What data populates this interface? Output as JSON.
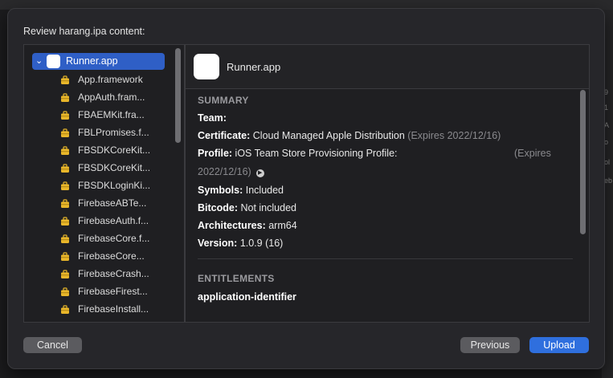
{
  "backdrop": {
    "glyphs": [
      "9",
      "1",
      "A",
      "o",
      "ol",
      "eb"
    ]
  },
  "sheet": {
    "title": "Review harang.ipa content:"
  },
  "tree": {
    "root": {
      "label": "Runner.app"
    },
    "items": [
      {
        "label": "App.framework"
      },
      {
        "label": "AppAuth.fram..."
      },
      {
        "label": "FBAEMKit.fra..."
      },
      {
        "label": "FBLPromises.f..."
      },
      {
        "label": "FBSDKCoreKit..."
      },
      {
        "label": "FBSDKCoreKit..."
      },
      {
        "label": "FBSDKLoginKi..."
      },
      {
        "label": "FirebaseABTe..."
      },
      {
        "label": "FirebaseAuth.f..."
      },
      {
        "label": "FirebaseCore.f..."
      },
      {
        "label": "FirebaseCore..."
      },
      {
        "label": "FirebaseCrash..."
      },
      {
        "label": "FirebaseFirest..."
      },
      {
        "label": "FirebaseInstall..."
      }
    ]
  },
  "detail": {
    "app_name": "Runner.app",
    "summary_title": "SUMMARY",
    "team_label": "Team:",
    "certificate_label": "Certificate:",
    "certificate_value": "Cloud Managed Apple Distribution",
    "certificate_expiry": "(Expires 2022/12/16)",
    "profile_label": "Profile:",
    "profile_value": "iOS Team Store Provisioning Profile:",
    "profile_expires": "(Expires",
    "profile_date": "2022/12/16)",
    "symbols_label": "Symbols:",
    "symbols_value": "Included",
    "bitcode_label": "Bitcode:",
    "bitcode_value": "Not included",
    "architectures_label": "Architectures:",
    "architectures_value": "arm64",
    "version_label": "Version:",
    "version_value": "1.0.9 (16)",
    "entitlements_title": "ENTITLEMENTS",
    "entitlement_key": "application-identifier"
  },
  "buttons": {
    "cancel": "Cancel",
    "previous": "Previous",
    "upload": "Upload"
  },
  "colors": {
    "accent": "#2f6fde",
    "selection": "#2f5fc6",
    "framework_icon": "#e8b62a"
  },
  "icons": {
    "framework": "briefcase-icon",
    "expand": "chevron-down-icon",
    "reveal": "arrow-circle-right-icon"
  }
}
